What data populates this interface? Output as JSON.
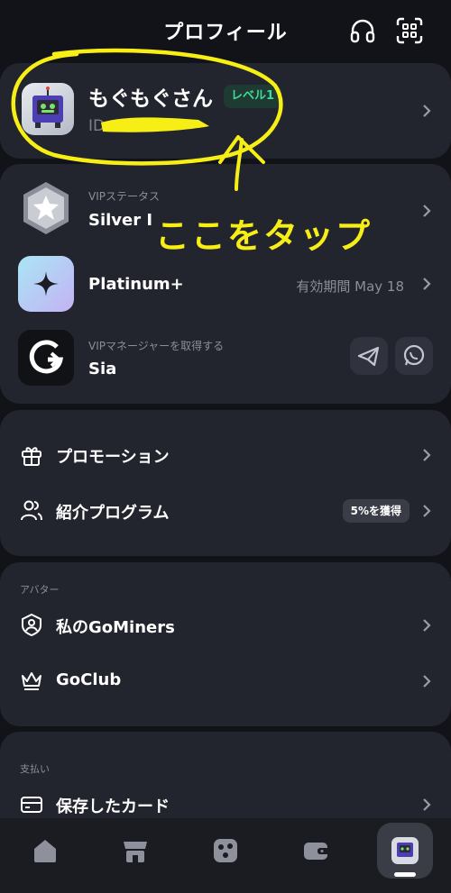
{
  "header": {
    "title": "プロフィール",
    "support_icon": "headset-icon",
    "scan_icon": "qr-scan-icon"
  },
  "profile": {
    "name": "もぐもぐさん",
    "level_badge": "レベル1",
    "id_prefix": "ID"
  },
  "vip": {
    "status_label": "VIPステータス",
    "status_value": "Silver I",
    "plan_name": "Platinum+",
    "plan_validity": "有効期間 May 18",
    "manager_label": "VIPマネージャーを取得する",
    "manager_name": "Sia",
    "telegram_icon": "telegram-icon",
    "whatsapp_icon": "whatsapp-icon"
  },
  "menu": {
    "promotion_label": "プロモーション",
    "referral_label": "紹介プログラム",
    "referral_badge": "5%を獲得"
  },
  "avatar_section": {
    "title": "アバター",
    "my_gominers_label": "私のGoMiners",
    "goclub_label": "GoClub"
  },
  "payment_section": {
    "title": "支払い",
    "saved_cards_label": "保存したカード"
  },
  "tabbar": {
    "items": [
      "home-icon",
      "store-icon",
      "miners-icon",
      "wallet-icon",
      "profile-avatar-icon"
    ],
    "active": "profile-avatar-icon"
  },
  "annotation": {
    "text": "ここをタップ",
    "color": "#f7ee15"
  },
  "colors": {
    "background": "#121318",
    "card": "#23252e",
    "accent_green": "#3ddc97",
    "annotation_yellow": "#f7ee15"
  }
}
